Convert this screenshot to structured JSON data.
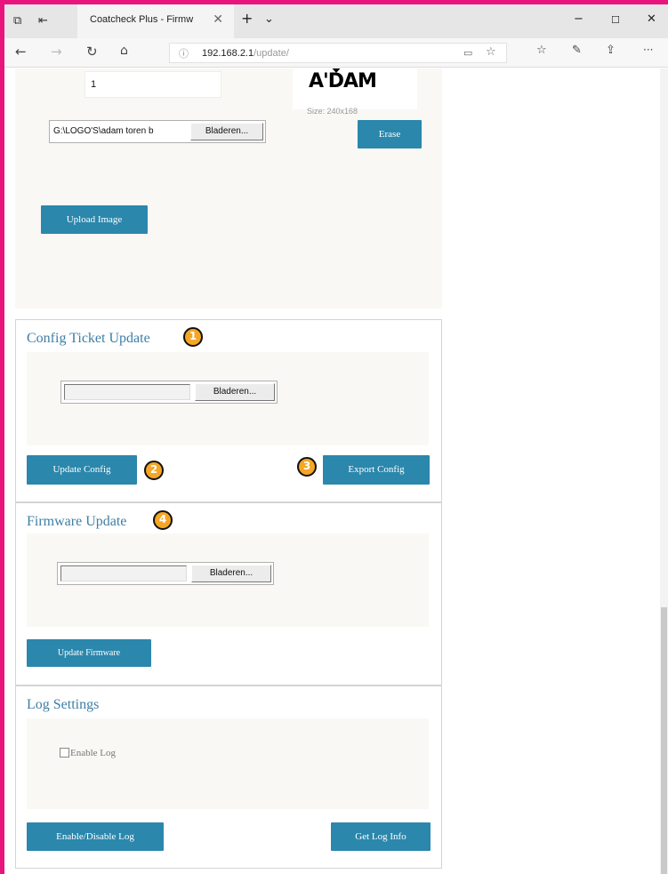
{
  "browser": {
    "tab_title": "Coatcheck Plus - Firmw",
    "tab_close": "✕",
    "new_tab": "+",
    "tab_list": "⌄",
    "minimize": "−",
    "maximize": "☐",
    "close": "✕",
    "url_host": "192.168.2.1",
    "url_path": "/update/",
    "more": "···"
  },
  "logo_upload": {
    "number_value": "1",
    "logo_text": "A'DAM",
    "logo_size": "Size: 240x168",
    "file_path": "G:\\LOGO'S\\adam toren b",
    "browse_label": "Bladeren...",
    "erase_label": "Erase",
    "upload_label": "Upload Image"
  },
  "config_section": {
    "title": "Config Ticket Update",
    "browse_label": "Bladeren...",
    "update_label": "Update Config",
    "export_label": "Export Config"
  },
  "firmware_section": {
    "title": "Firmware Update",
    "browse_label": "Bladeren...",
    "update_label": "Update Firmware"
  },
  "log_section": {
    "title": "Log Settings",
    "checkbox_label": "Enable Log",
    "toggle_label": "Enable/Disable Log",
    "info_label": "Get Log Info"
  },
  "callouts": [
    "1",
    "2",
    "3",
    "4"
  ],
  "colors": {
    "accent_magenta": "#e8157f",
    "button_blue": "#2b87ac",
    "title_blue": "#3d7ea5",
    "callout_orange": "#f5a623",
    "panel_bg": "#f9f8f4"
  },
  "icons": [
    "tab-actions-icon",
    "back-tabs-icon",
    "back-icon",
    "forward-icon",
    "refresh-icon",
    "home-icon",
    "info-icon",
    "reading-view-icon",
    "favorite-star-icon",
    "favorites-hub-icon",
    "pen-icon",
    "share-icon"
  ]
}
